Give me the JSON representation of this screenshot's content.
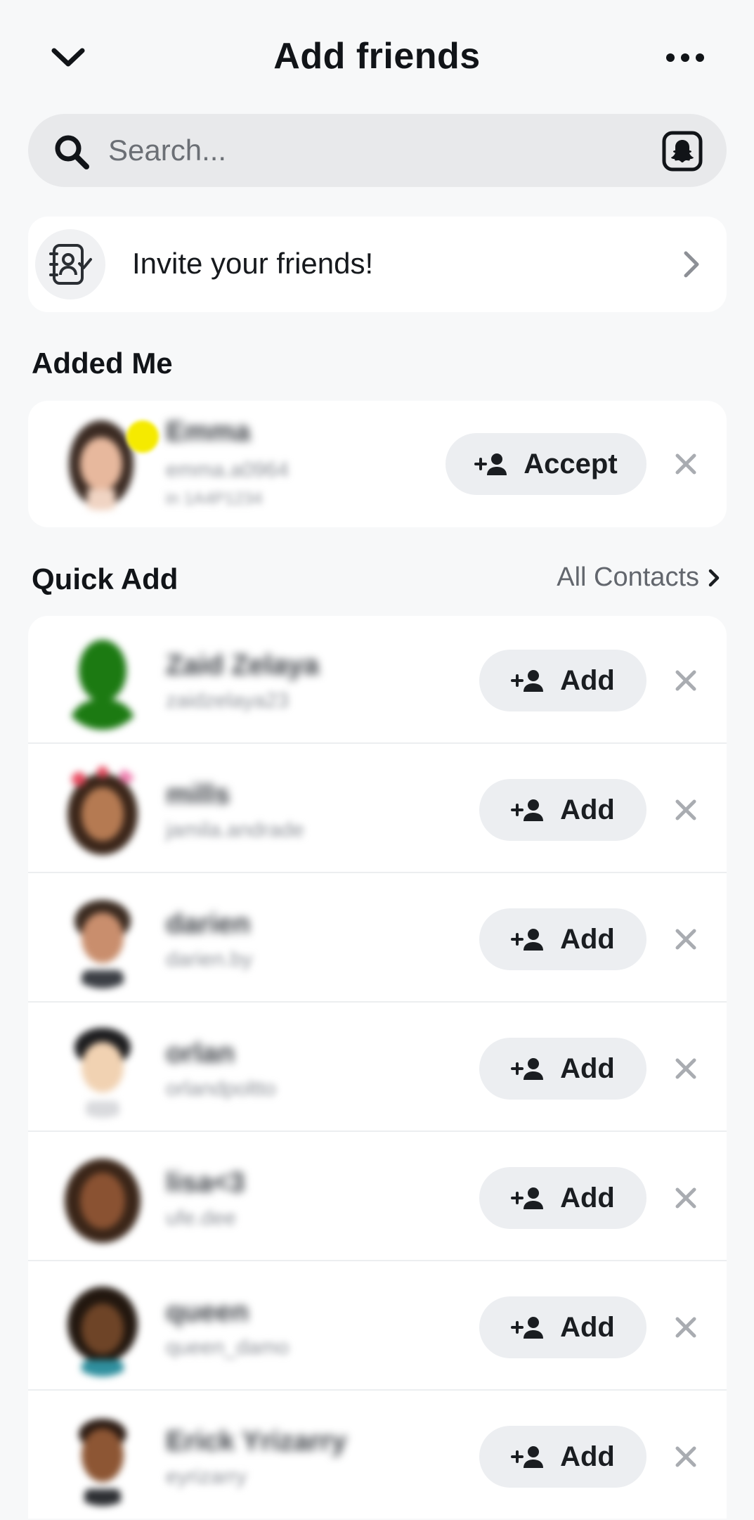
{
  "header": {
    "title": "Add friends"
  },
  "search": {
    "placeholder": "Search..."
  },
  "invite": {
    "label": "Invite your friends!"
  },
  "added_me": {
    "section_title": "Added Me",
    "accept_label": "Accept",
    "items": [
      {
        "name": "Emma",
        "username": "emma.a0964",
        "extra": "in 1A4P1234"
      }
    ]
  },
  "quick_add": {
    "section_title": "Quick Add",
    "all_contacts_label": "All Contacts",
    "add_label": "Add",
    "items": [
      {
        "name": "Zaid Zelaya",
        "username": "zaidzelaya23"
      },
      {
        "name": "mills",
        "username": "jamila.andrade"
      },
      {
        "name": "darien",
        "username": "darien.by"
      },
      {
        "name": "orlan",
        "username": "orlandpoltto"
      },
      {
        "name": "lisa<3",
        "username": "ufe.dee"
      },
      {
        "name": "queen",
        "username": "queen_damo"
      },
      {
        "name": "Erick Yrizarry",
        "username": "eyrizarry"
      }
    ]
  },
  "colors": {
    "background": "#f7f8f9",
    "card": "#ffffff",
    "button_bg": "#eceef1",
    "search_bg": "#e8e9eb",
    "presence_dot": "#f5ea00"
  }
}
